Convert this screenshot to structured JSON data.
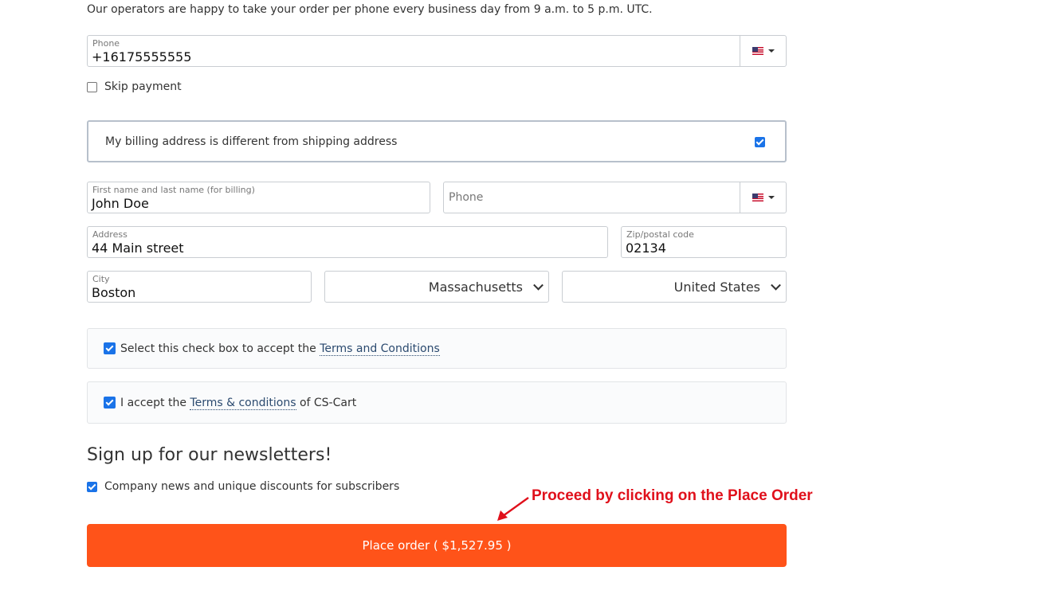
{
  "intro_text": "Our operators are happy to take your order per phone every business day from 9 a.m. to 5 p.m. UTC.",
  "phone": {
    "label": "Phone",
    "value": "+16175555555",
    "country_icon": "us-flag-icon"
  },
  "skip_payment": {
    "label": "Skip payment",
    "checked": false
  },
  "billing_different": {
    "label": "My billing address is different from shipping address",
    "checked": true
  },
  "billing": {
    "name": {
      "label": "First name and last name (for billing)",
      "value": "John Doe"
    },
    "phone": {
      "placeholder": "Phone",
      "country_icon": "us-flag-icon"
    },
    "address": {
      "label": "Address",
      "value": "44 Main street"
    },
    "zip": {
      "label": "Zip/postal code",
      "value": "02134"
    },
    "city": {
      "label": "City",
      "value": "Boston"
    },
    "state": {
      "value": "Massachusetts"
    },
    "country": {
      "value": "United States"
    }
  },
  "terms1": {
    "prefix": "Select this check box to accept the ",
    "link": "Terms and Conditions",
    "checked": true
  },
  "terms2": {
    "prefix": "I accept the ",
    "link": "Terms & conditions",
    "suffix": " of CS-Cart",
    "checked": true
  },
  "newsletter": {
    "title": "Sign up for our newsletters!",
    "option_label": "Company news and unique discounts for subscribers",
    "checked": true
  },
  "place_order": {
    "label": "Place order ( $1,527.95 )"
  },
  "annotation": {
    "text": "Proceed by clicking on the Place Order",
    "color": "#e0101b"
  },
  "colors": {
    "accent": "#ff5319",
    "checkbox": "#1a73e8",
    "link": "#2b4a6f"
  }
}
